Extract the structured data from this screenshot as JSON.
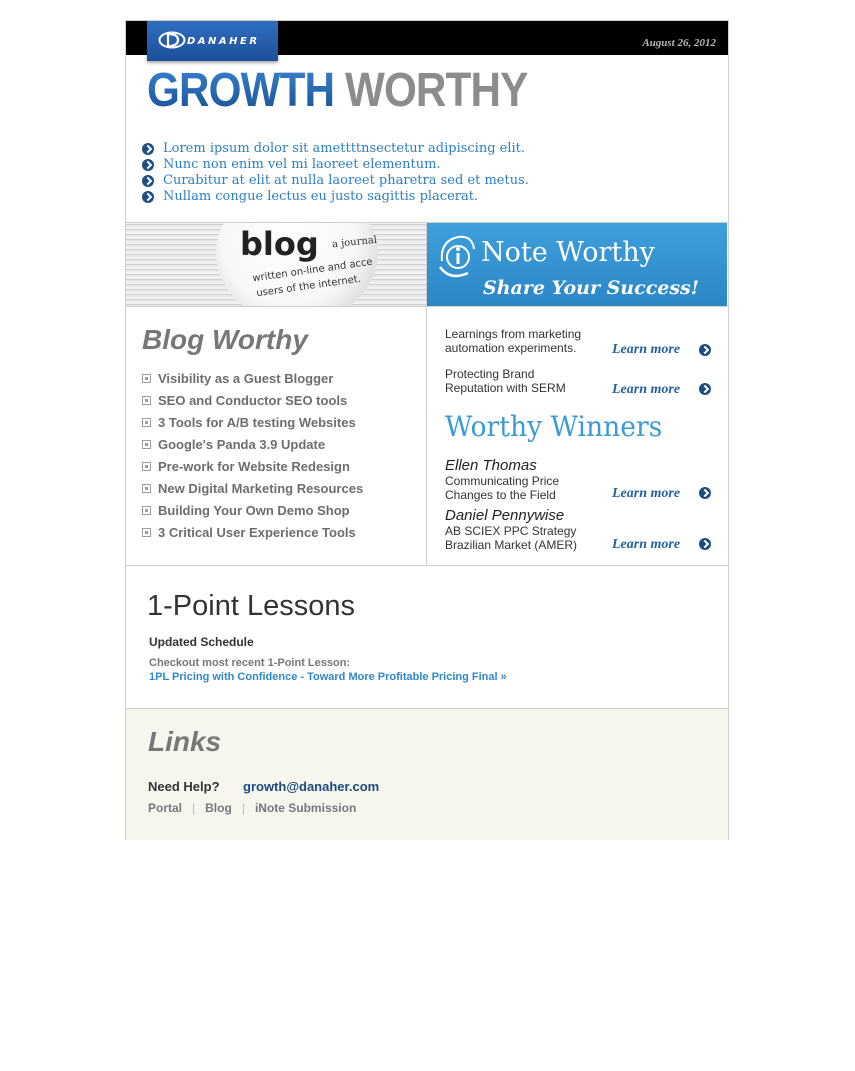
{
  "header": {
    "logo_text": "DANAHER",
    "date": "August 26, 2012",
    "title_part1": "GROWTH",
    "title_part2": "WORTHY"
  },
  "intro_bullets": [
    "Lorem ipsum dolor sit amettttnsectetur adipiscing elit.",
    "Nunc non enim vel mi laoreet elementum.",
    "Curabitur at elit at nulla laoreet pharetra sed et metus.",
    "Nullam congue lectus eu justo sagittis placerat."
  ],
  "blog_image": {
    "big_word": "blog",
    "line1": "a journal",
    "line2": "written on-line and acce",
    "line3": "users of the internet."
  },
  "inote_banner": {
    "title": "Note Worthy",
    "subtitle": "Share Your Success!"
  },
  "blog_worthy": {
    "heading": "Blog Worthy",
    "items": [
      "Visibility as a Guest Blogger",
      "SEO and Conductor SEO tools",
      "3 Tools for A/B testing Websites",
      "Google's Panda 3.9 Update",
      "Pre-work for Website Redesign",
      "New Digital Marketing Resources",
      "Building Your Own Demo Shop",
      "3 Critical User Experience Tools"
    ]
  },
  "note_items": [
    {
      "line1": "Learnings from marketing",
      "line2": "automation experiments.",
      "link": "Learn more"
    },
    {
      "line1": "Protecting Brand",
      "line2": "Reputation with SERM",
      "link": "Learn more"
    }
  ],
  "worthy_winners": {
    "heading": "Worthy Winners",
    "winners": [
      {
        "name": "Ellen Thomas",
        "line1": "Communicating Price",
        "line2": "Changes to the Field",
        "link": "Learn more"
      },
      {
        "name": "Daniel Pennywise",
        "line1": "AB SCIEX PPC Strategy",
        "line2": "Brazilian Market (AMER)",
        "link": "Learn more"
      }
    ]
  },
  "lessons": {
    "heading": "1-Point Lessons",
    "schedule": "Updated Schedule",
    "checkout": "Checkout most recent 1-Point Lesson:",
    "link": "1PL Pricing with Confidence - Toward More Profitable Pricing Final »"
  },
  "links": {
    "heading": "Links",
    "help_label": "Need Help?",
    "email": "growth@danaher.com",
    "nav": [
      "Portal",
      "Blog",
      "iNote Submission"
    ],
    "separator": "|"
  },
  "colors": {
    "accent_blue": "#2c7fc0",
    "banner_blue": "#3ea0dc",
    "header_black": "#000000",
    "links_bg": "#f6f6ef"
  }
}
